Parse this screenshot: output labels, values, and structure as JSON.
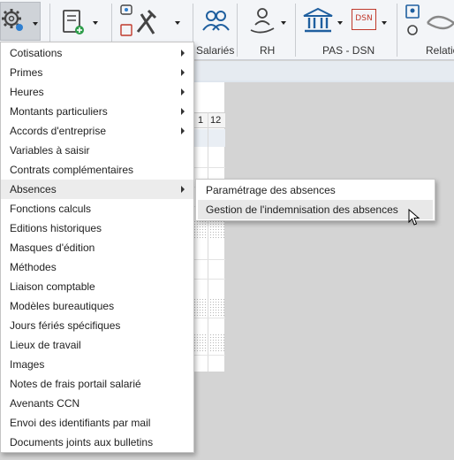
{
  "ribbon": {
    "groups": [
      {
        "label": "Salariés"
      },
      {
        "label": "RH"
      },
      {
        "label": "PAS - DSN"
      },
      {
        "label": "Relatio"
      }
    ],
    "dsn_icon_text": "DSN"
  },
  "grid": {
    "column_numbers": [
      "1",
      "12"
    ]
  },
  "menu": {
    "items": [
      {
        "label": "Cotisations",
        "has_submenu": true
      },
      {
        "label": "Primes",
        "has_submenu": true
      },
      {
        "label": "Heures",
        "has_submenu": true
      },
      {
        "label": "Montants particuliers",
        "has_submenu": true
      },
      {
        "label": "Accords d'entreprise",
        "has_submenu": true
      },
      {
        "label": "Variables à saisir",
        "has_submenu": false
      },
      {
        "label": "Contrats complémentaires",
        "has_submenu": false
      },
      {
        "label": "Absences",
        "has_submenu": true,
        "active": true
      },
      {
        "label": "Fonctions calculs",
        "has_submenu": false
      },
      {
        "label": "Editions historiques",
        "has_submenu": false
      },
      {
        "label": "Masques d'édition",
        "has_submenu": false
      },
      {
        "label": "Méthodes",
        "has_submenu": false
      },
      {
        "label": "Liaison comptable",
        "has_submenu": false
      },
      {
        "label": "Modèles bureautiques",
        "has_submenu": false
      },
      {
        "label": "Jours fériés spécifiques",
        "has_submenu": false
      },
      {
        "label": "Lieux de travail",
        "has_submenu": false
      },
      {
        "label": "Images",
        "has_submenu": false
      },
      {
        "label": "Notes de frais portail salarié",
        "has_submenu": false
      },
      {
        "label": "Avenants CCN",
        "has_submenu": false
      },
      {
        "label": "Envoi des identifiants par mail",
        "has_submenu": false
      },
      {
        "label": "Documents joints aux bulletins",
        "has_submenu": false
      }
    ]
  },
  "submenu": {
    "items": [
      {
        "label": "Paramétrage des absences"
      },
      {
        "label": "Gestion de l'indemnisation des absences",
        "hovered": true
      }
    ]
  },
  "colors": {
    "ribbon_bg": "#f3f5f8",
    "menu_hover": "#ececec",
    "icon_blue": "#1f5f9f"
  }
}
